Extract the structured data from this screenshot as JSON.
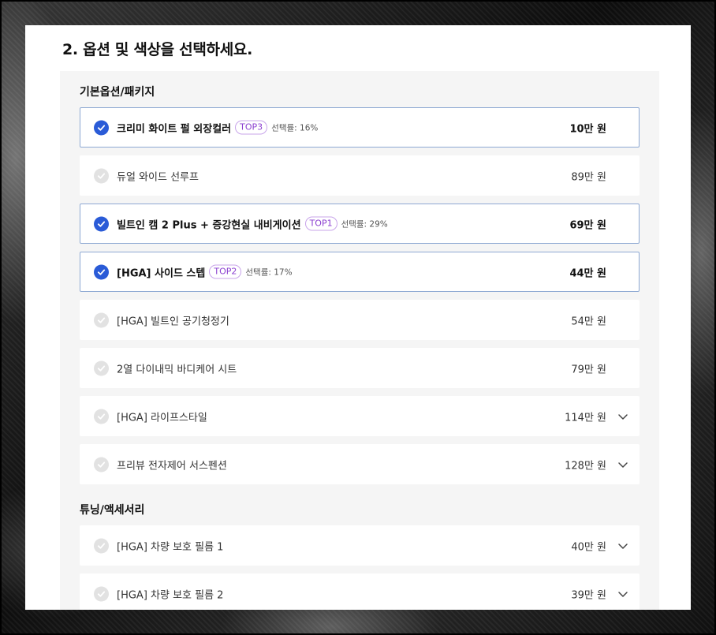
{
  "section": {
    "title": "2. 옵션 및 색상을 선택하세요."
  },
  "groups": [
    {
      "title": "기본옵션/패키지"
    },
    {
      "title": "튜닝/액세서리"
    }
  ],
  "options": [
    {
      "name": "크리미 화이트 펄 외장컬러",
      "badge": "TOP3",
      "rate": "선택률: 16%",
      "price": "10만 원",
      "selected": true,
      "expandable": false
    },
    {
      "name": "듀얼 와이드 선루프",
      "price": "89만 원",
      "selected": false,
      "expandable": false
    },
    {
      "name": "빌트인 캠 2 Plus + 증강현실 내비게이션",
      "badge": "TOP1",
      "rate": "선택률: 29%",
      "price": "69만 원",
      "selected": true,
      "expandable": false
    },
    {
      "name": "[HGA] 사이드 스텝",
      "badge": "TOP2",
      "rate": "선택률: 17%",
      "price": "44만 원",
      "selected": true,
      "expandable": false
    },
    {
      "name": "[HGA] 빌트인 공기청정기",
      "price": "54만 원",
      "selected": false,
      "expandable": false
    },
    {
      "name": "2열 다이내믹 바디케어 시트",
      "price": "79만 원",
      "selected": false,
      "expandable": false
    },
    {
      "name": "[HGA] 라이프스타일",
      "price": "114만 원",
      "selected": false,
      "expandable": true
    },
    {
      "name": "프리뷰 전자제어 서스펜션",
      "price": "128만 원",
      "selected": false,
      "expandable": true
    },
    {
      "name": "[HGA] 차량 보호 필름 1",
      "price": "40만 원",
      "selected": false,
      "expandable": true
    },
    {
      "name": "[HGA] 차량 보호 필름 2",
      "price": "39만 원",
      "selected": false,
      "expandable": true
    }
  ],
  "icons": {
    "check": "check-icon",
    "expand": "chevron-down-icon"
  },
  "colors": {
    "selected_check": "#2a5bd7",
    "selected_border": "#8ea9d3",
    "badge": "#8b3fd0"
  }
}
